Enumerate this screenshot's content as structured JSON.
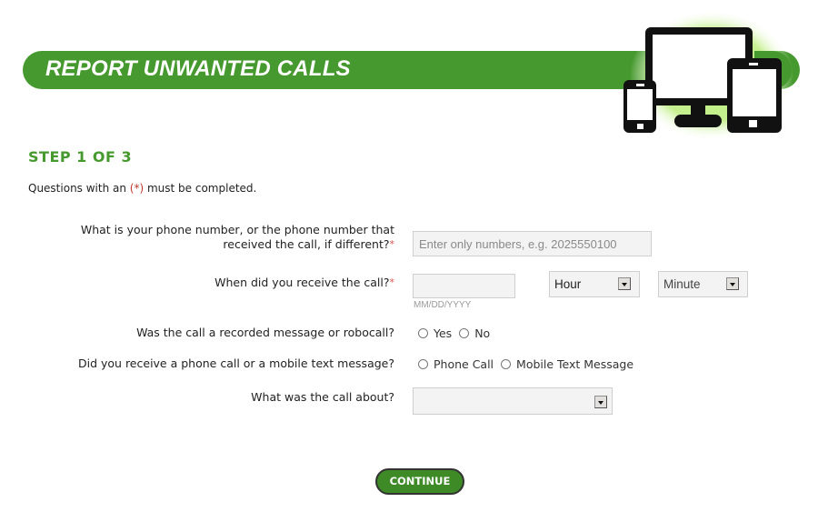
{
  "header": {
    "title": "REPORT UNWANTED CALLS",
    "brand_color": "#46992e",
    "illustration": "devices-icon"
  },
  "step": {
    "title": "STEP 1 OF 3",
    "required_note_prefix": "Questions with an ",
    "required_note_marker": "(*)",
    "required_note_suffix": " must be completed."
  },
  "form": {
    "phone": {
      "label_line1": "What is your phone number, or the phone number that",
      "label_line2": "received the call, if different?",
      "required": "*",
      "value": "",
      "placeholder": "Enter only numbers, e.g. 2025550100"
    },
    "when": {
      "label": "When did you receive the call?",
      "required": "*",
      "date_value": "",
      "date_hint": "MM/DD/YYYY",
      "hour_selected": "Hour",
      "minute_selected": "Minute"
    },
    "robocall": {
      "label": "Was the call a recorded message or robocall?",
      "options": [
        "Yes",
        "No"
      ],
      "selected": null
    },
    "call_type": {
      "label": "Did you receive a phone call or a mobile text message?",
      "options": [
        "Phone Call",
        "Mobile Text Message"
      ],
      "selected": null
    },
    "subject": {
      "label": "What was the call about?",
      "selected": ""
    }
  },
  "actions": {
    "continue_label": "CONTINUE"
  }
}
